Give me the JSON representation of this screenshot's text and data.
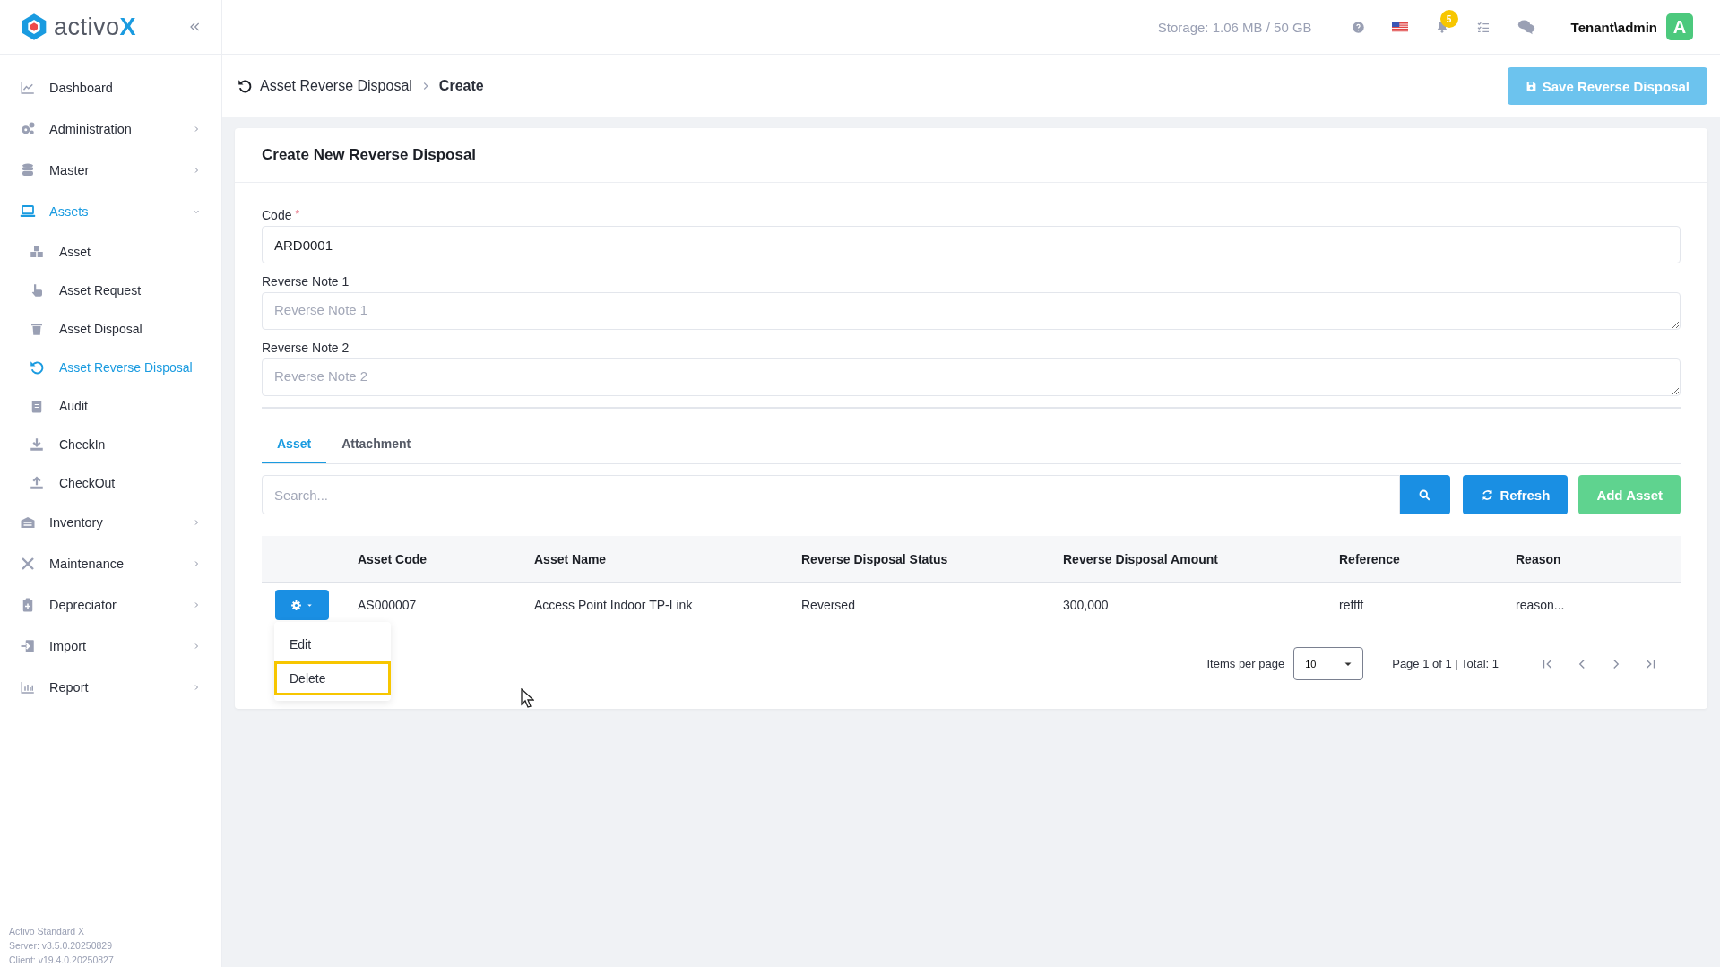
{
  "logo": {
    "text": "activo",
    "accent": "X"
  },
  "sidebar": {
    "items": [
      {
        "label": "Dashboard",
        "kind": "link",
        "selected": false
      },
      {
        "label": "Administration",
        "kind": "group",
        "expanded": false,
        "selected": false
      },
      {
        "label": "Master",
        "kind": "group",
        "expanded": false,
        "selected": false
      },
      {
        "label": "Assets",
        "kind": "group",
        "expanded": true,
        "selected": true,
        "children": [
          {
            "label": "Asset",
            "selected": false
          },
          {
            "label": "Asset Request",
            "selected": false
          },
          {
            "label": "Asset Disposal",
            "selected": false
          },
          {
            "label": "Asset Reverse Disposal",
            "selected": true
          },
          {
            "label": "Audit",
            "selected": false
          },
          {
            "label": "CheckIn",
            "selected": false
          },
          {
            "label": "CheckOut",
            "selected": false
          }
        ]
      },
      {
        "label": "Inventory",
        "kind": "group",
        "expanded": false,
        "selected": false
      },
      {
        "label": "Maintenance",
        "kind": "group",
        "expanded": false,
        "selected": false
      },
      {
        "label": "Depreciator",
        "kind": "group",
        "expanded": false,
        "selected": false
      },
      {
        "label": "Import",
        "kind": "group",
        "expanded": false,
        "selected": false
      },
      {
        "label": "Report",
        "kind": "group",
        "expanded": false,
        "selected": false
      }
    ]
  },
  "footer": [
    "Activo Standard X",
    "Server: v3.5.0.20250829",
    "Client: v19.4.0.20250827"
  ],
  "header": {
    "storage": "Storage: 1.06 MB / 50 GB",
    "notification_count": "5",
    "user": "Tenant\\admin",
    "avatar": "A"
  },
  "breadcrumb": [
    "Asset Reverse Disposal",
    "Create"
  ],
  "save_button": {
    "label": "Save Reverse Disposal",
    "disabled": true
  },
  "form": {
    "title": "Create New Reverse Disposal",
    "required_mark": "*",
    "fields": [
      {
        "label": "Code",
        "required": true,
        "kind": "input",
        "value": "ARD0001"
      },
      {
        "label": "Reverse Note 1",
        "required": false,
        "kind": "textarea",
        "placeholder": "Reverse Note 1"
      },
      {
        "label": "Reverse Note 2",
        "required": false,
        "kind": "textarea",
        "placeholder": "Reverse Note 2"
      }
    ]
  },
  "tabs": [
    {
      "label": "Asset",
      "selected": true
    },
    {
      "label": "Attachment",
      "selected": false
    }
  ],
  "search": {
    "placeholder": "Search..."
  },
  "buttons": {
    "refresh": "Refresh",
    "add": "Add Asset"
  },
  "table": {
    "columns": [
      "Asset Code",
      "Asset Name",
      "Reverse Disposal Status",
      "Reverse Disposal Amount",
      "Reference",
      "Reason"
    ],
    "rows": [
      [
        "AS000007",
        "Access Point Indoor TP-Link",
        "Reversed",
        "300,000",
        "reffff",
        "reason..."
      ]
    ]
  },
  "row_menu": {
    "items": [
      {
        "label": "Edit",
        "highlighted": false
      },
      {
        "label": "Delete",
        "highlighted": true
      }
    ]
  },
  "pagination": {
    "items_per_page_label": "Items per page",
    "page_size": "10",
    "summary": "Page 1 of 1 | Total: 1"
  }
}
